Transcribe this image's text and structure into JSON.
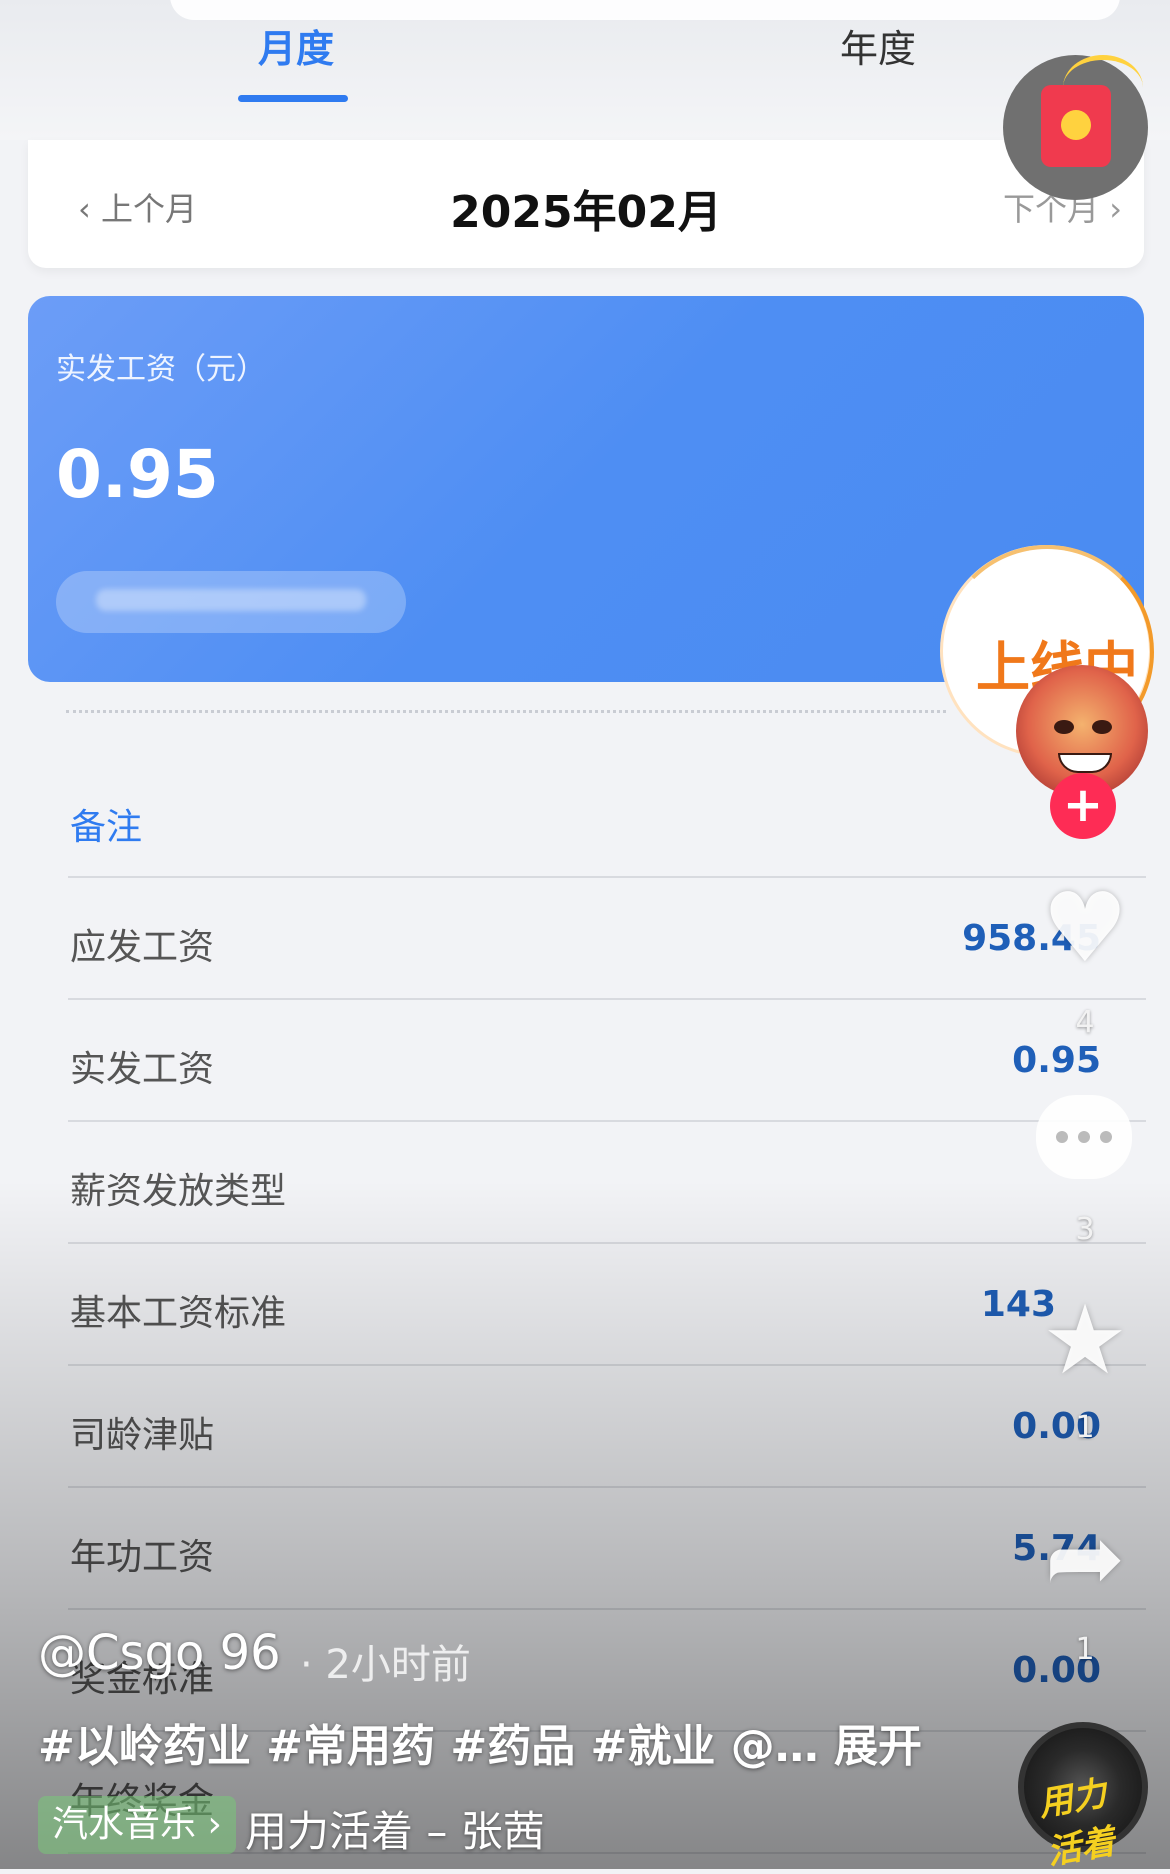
{
  "tabs": {
    "monthly": "月度",
    "yearly": "年度"
  },
  "month_nav": {
    "prev": "上个月",
    "current": "2025年02月",
    "next": "下个月"
  },
  "salary_card": {
    "label": "实发工资（元）",
    "value": "0.95"
  },
  "overlay": {
    "online": "上线中"
  },
  "rows": [
    {
      "label": "备注",
      "value": ""
    },
    {
      "label": "应发工资",
      "value": "958.45"
    },
    {
      "label": "实发工资",
      "value": "0.95"
    },
    {
      "label": "薪资发放类型",
      "value": ""
    },
    {
      "label": "基本工资标准",
      "value": "143"
    },
    {
      "label": "司龄津贴",
      "value": "0.00"
    },
    {
      "label": "年功工资",
      "value": "5.74"
    },
    {
      "label": "奖金标准",
      "value": "0.00"
    },
    {
      "label": "年终奖金",
      "value": ""
    }
  ],
  "side_counts": {
    "likes": "4",
    "comments": "3",
    "favorites": "1",
    "shares": "1"
  },
  "post": {
    "username": "@Csgo 96",
    "time": "· 2小时前",
    "tags": "#以岭药业 #常用药 #药品 #就业 @…  展开",
    "music_tag": "汽水音乐 ›",
    "song": "用力活着 – 张茜",
    "disc_text": "用力活着"
  }
}
